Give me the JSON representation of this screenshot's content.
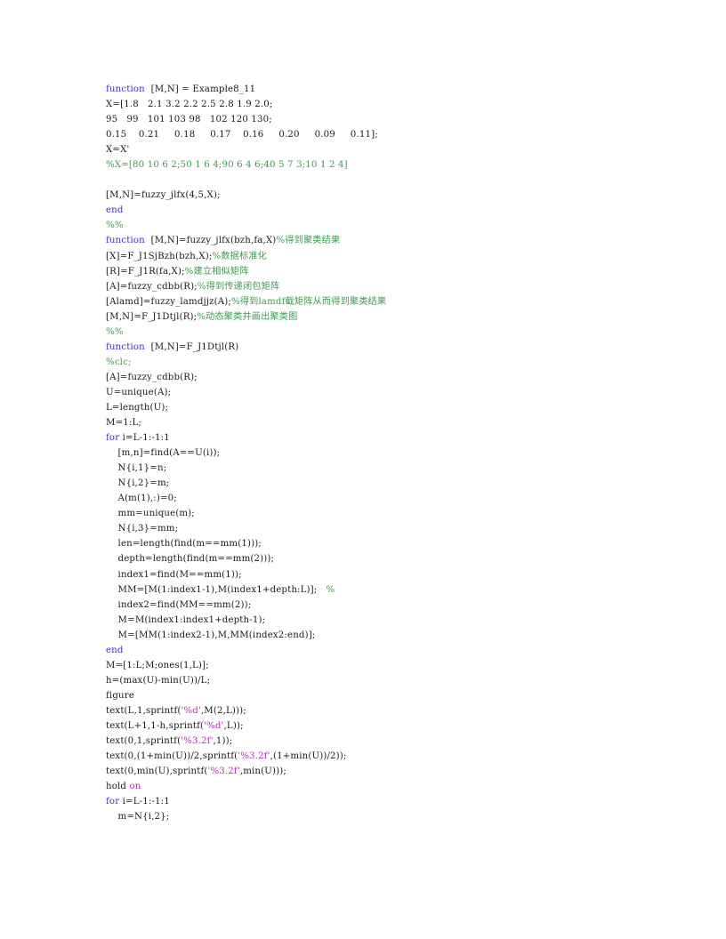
{
  "document": {
    "kind": "matlab-source-listing",
    "page_background": "#ffffff",
    "colors": {
      "keyword": "#3a30cf",
      "comment": "#3f9b4e",
      "string": "#b62fb6",
      "plain": "#1a1a1a"
    }
  },
  "code": {
    "lines": [
      {
        "tokens": [
          {
            "t": "function",
            "c": "kw"
          },
          {
            "t": "  [M,N] = Example8_11",
            "c": "pl"
          }
        ]
      },
      {
        "tokens": [
          {
            "t": "X=[1.8   2.1 3.2 2.2 2.5 2.8 1.9 2.0;",
            "c": "pl"
          }
        ]
      },
      {
        "tokens": [
          {
            "t": "95   99   101 103 98   102 120 130;",
            "c": "pl"
          }
        ]
      },
      {
        "tokens": [
          {
            "t": "0.15    0.21     0.18     0.17    0.16     0.20     0.09     0.11];",
            "c": "pl"
          }
        ]
      },
      {
        "tokens": [
          {
            "t": "X=X'",
            "c": "pl"
          }
        ]
      },
      {
        "tokens": [
          {
            "t": "%X=[80 10 6 2;50 1 6 4;90 6 4 6;40 5 7 3;10 1 2 4]",
            "c": "cm"
          }
        ]
      },
      {
        "tokens": []
      },
      {
        "tokens": [
          {
            "t": "[M,N]=fuzzy_jlfx(4,5,X);",
            "c": "pl"
          }
        ]
      },
      {
        "tokens": [
          {
            "t": "end",
            "c": "kw"
          }
        ]
      },
      {
        "tokens": [
          {
            "t": "%%",
            "c": "cm"
          }
        ]
      },
      {
        "tokens": [
          {
            "t": "function",
            "c": "kw"
          },
          {
            "t": "  [M,N]=fuzzy_jlfx(bzh,fa,X)",
            "c": "pl"
          },
          {
            "t": "%得到聚类结果",
            "c": "cm"
          }
        ]
      },
      {
        "tokens": [
          {
            "t": "[X]=F_J1SjBzh(bzh,X);",
            "c": "pl"
          },
          {
            "t": "%数据标准化",
            "c": "cm"
          }
        ]
      },
      {
        "tokens": [
          {
            "t": "[R]=F_J1R(fa,X);",
            "c": "pl"
          },
          {
            "t": "%建立相似矩阵",
            "c": "cm"
          }
        ]
      },
      {
        "tokens": [
          {
            "t": "[A]=fuzzy_cdbb(R);",
            "c": "pl"
          },
          {
            "t": "%得到传递闭包矩阵",
            "c": "cm"
          }
        ]
      },
      {
        "tokens": [
          {
            "t": "[Alamd]=fuzzy_lamdjjz(A);",
            "c": "pl"
          },
          {
            "t": "%得到lamdf截矩阵从而得到聚类结果",
            "c": "cm"
          }
        ]
      },
      {
        "tokens": [
          {
            "t": "[M,N]=F_J1Dtjl(R);",
            "c": "pl"
          },
          {
            "t": "%动态聚类并画出聚类图",
            "c": "cm"
          }
        ]
      },
      {
        "tokens": [
          {
            "t": "%%",
            "c": "cm"
          }
        ]
      },
      {
        "tokens": [
          {
            "t": "function",
            "c": "kw"
          },
          {
            "t": "  [M,N]=F_J1Dtjl(R)",
            "c": "pl"
          }
        ]
      },
      {
        "tokens": [
          {
            "t": "%clc;",
            "c": "cm"
          }
        ]
      },
      {
        "tokens": [
          {
            "t": "[A]=fuzzy_cdbb(R);",
            "c": "pl"
          }
        ]
      },
      {
        "tokens": [
          {
            "t": "U=unique(A);",
            "c": "pl"
          }
        ]
      },
      {
        "tokens": [
          {
            "t": "L=length(U);",
            "c": "pl"
          }
        ]
      },
      {
        "tokens": [
          {
            "t": "M=1:L;",
            "c": "pl"
          }
        ]
      },
      {
        "tokens": [
          {
            "t": "for",
            "c": "kw"
          },
          {
            "t": " i=L-1:-1:1",
            "c": "pl"
          }
        ]
      },
      {
        "tokens": [
          {
            "t": "    [m,n]=find(A==U(i));",
            "c": "pl"
          }
        ]
      },
      {
        "tokens": [
          {
            "t": "    N{i,1}=n;",
            "c": "pl"
          }
        ]
      },
      {
        "tokens": [
          {
            "t": "    N{i,2}=m;",
            "c": "pl"
          }
        ]
      },
      {
        "tokens": [
          {
            "t": "    A(m(1),:)=0;",
            "c": "pl"
          }
        ]
      },
      {
        "tokens": [
          {
            "t": "    mm=unique(m);",
            "c": "pl"
          }
        ]
      },
      {
        "tokens": [
          {
            "t": "    N{i,3}=mm;",
            "c": "pl"
          }
        ]
      },
      {
        "tokens": [
          {
            "t": "    len=length(find(m==mm(1)));",
            "c": "pl"
          }
        ]
      },
      {
        "tokens": [
          {
            "t": "    depth=length(find(m==mm(2)));",
            "c": "pl"
          }
        ]
      },
      {
        "tokens": [
          {
            "t": "    index1=find(M==mm(1));",
            "c": "pl"
          }
        ]
      },
      {
        "tokens": [
          {
            "t": "    MM=[M(1:index1-1),M(index1+depth:L)];   ",
            "c": "pl"
          },
          {
            "t": "%",
            "c": "cm"
          }
        ]
      },
      {
        "tokens": [
          {
            "t": "    index2=find(MM==mm(2));",
            "c": "pl"
          }
        ]
      },
      {
        "tokens": [
          {
            "t": "    M=M(index1:index1+depth-1);",
            "c": "pl"
          }
        ]
      },
      {
        "tokens": [
          {
            "t": "    M=[MM(1:index2-1),M,MM(index2:end)];",
            "c": "pl"
          }
        ]
      },
      {
        "tokens": [
          {
            "t": "end",
            "c": "kw"
          }
        ]
      },
      {
        "tokens": [
          {
            "t": "M=[1:L;M;ones(1,L)];",
            "c": "pl"
          }
        ]
      },
      {
        "tokens": [
          {
            "t": "h=(max(U)-min(U))/L;",
            "c": "pl"
          }
        ]
      },
      {
        "tokens": [
          {
            "t": "figure",
            "c": "pl"
          }
        ]
      },
      {
        "tokens": [
          {
            "t": "text(L,1,sprintf(",
            "c": "pl"
          },
          {
            "t": "'%d'",
            "c": "str"
          },
          {
            "t": ",M(2,L)));",
            "c": "pl"
          }
        ]
      },
      {
        "tokens": [
          {
            "t": "text(L+1,1-h,sprintf(",
            "c": "pl"
          },
          {
            "t": "'%d'",
            "c": "str"
          },
          {
            "t": ",L));",
            "c": "pl"
          }
        ]
      },
      {
        "tokens": [
          {
            "t": "text(0,1,sprintf(",
            "c": "pl"
          },
          {
            "t": "'%3.2f'",
            "c": "str"
          },
          {
            "t": ",1));",
            "c": "pl"
          }
        ]
      },
      {
        "tokens": [
          {
            "t": "text(0,(1+min(U))/2,sprintf(",
            "c": "pl"
          },
          {
            "t": "'%3.2f'",
            "c": "str"
          },
          {
            "t": ",(1+min(U))/2));",
            "c": "pl"
          }
        ]
      },
      {
        "tokens": [
          {
            "t": "text(0,min(U),sprintf(",
            "c": "pl"
          },
          {
            "t": "'%3.2f'",
            "c": "str"
          },
          {
            "t": ",min(U)));",
            "c": "pl"
          }
        ]
      },
      {
        "tokens": [
          {
            "t": "hold ",
            "c": "pl"
          },
          {
            "t": "on",
            "c": "str"
          }
        ]
      },
      {
        "tokens": [
          {
            "t": "for",
            "c": "kw"
          },
          {
            "t": " i=L-1:-1:1",
            "c": "pl"
          }
        ]
      },
      {
        "tokens": [
          {
            "t": "    m=N{i,2};",
            "c": "pl"
          }
        ]
      }
    ]
  }
}
